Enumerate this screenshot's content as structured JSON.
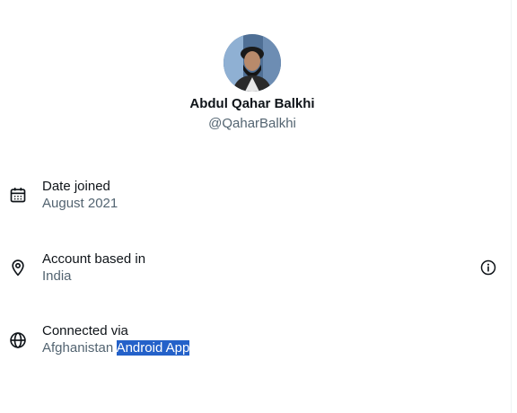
{
  "profile": {
    "name": "Abdul Qahar Balkhi",
    "handle": "@QaharBalkhi"
  },
  "details": [
    {
      "title": "Date joined",
      "value": "August 2021",
      "icon": "calendar-icon"
    },
    {
      "title": "Account based in",
      "value": "India",
      "icon": "location-pin-icon",
      "action_icon": "info-icon"
    },
    {
      "title": "Connected via",
      "value_plain": "Afghanistan",
      "value_selected": "Android App",
      "icon": "globe-icon"
    }
  ],
  "colors": {
    "primary_text": "#0f1419",
    "secondary_text": "#536471",
    "selection": "#2461c9"
  }
}
